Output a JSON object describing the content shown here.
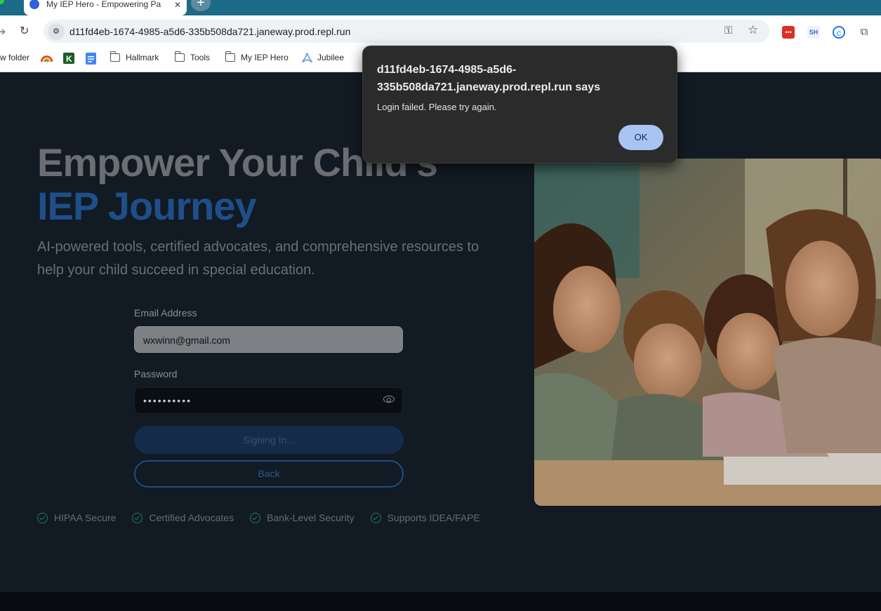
{
  "browser": {
    "tab_title": "My IEP Hero - Empowering Pa",
    "tab_close": "✕",
    "new_tab": "+",
    "url": "d11fd4eb-1674-4985-a5d6-335b508da721.janeway.prod.repl.run",
    "extensions": [
      "•••",
      "SH",
      "C",
      "⧉"
    ]
  },
  "bookmarks": [
    {
      "label": "w folder",
      "icon": "folder-icon"
    },
    {
      "label": "",
      "icon": "rainbow-icon"
    },
    {
      "label": "",
      "icon": "k-icon"
    },
    {
      "label": "",
      "icon": "docs-icon"
    },
    {
      "label": "Hallmark",
      "icon": "folder-icon"
    },
    {
      "label": "Tools",
      "icon": "folder-icon"
    },
    {
      "label": "My IEP Hero",
      "icon": "folder-icon"
    },
    {
      "label": "Jubilee",
      "icon": "jubilee-icon"
    }
  ],
  "hero": {
    "title_line1": "Empower Your Child's",
    "title_line2": "IEP Journey",
    "subtitle": "AI-powered tools, certified advocates, and comprehensive resources to help your child succeed in special education."
  },
  "form": {
    "email_label": "Email Address",
    "email_value": "wxwinn@gmail.com",
    "password_label": "Password",
    "password_value": "••••••••••",
    "submit_label": "Signing In...",
    "back_label": "Back"
  },
  "features": [
    "HIPAA Secure",
    "Certified Advocates",
    "Bank-Level Security",
    "Supports IDEA/FAPE"
  ],
  "dialog": {
    "title": "d11fd4eb-1674-4985-a5d6-335b508da721.janeway.prod.repl.run says",
    "message": "Login failed. Please try again.",
    "ok_label": "OK"
  },
  "colors": {
    "accent": "#1e4f8a",
    "tabbar": "#1b6b86",
    "dialog_bg": "#2b2b2b",
    "ok_button": "#a9c4f3",
    "check_green": "#1f7d52"
  }
}
